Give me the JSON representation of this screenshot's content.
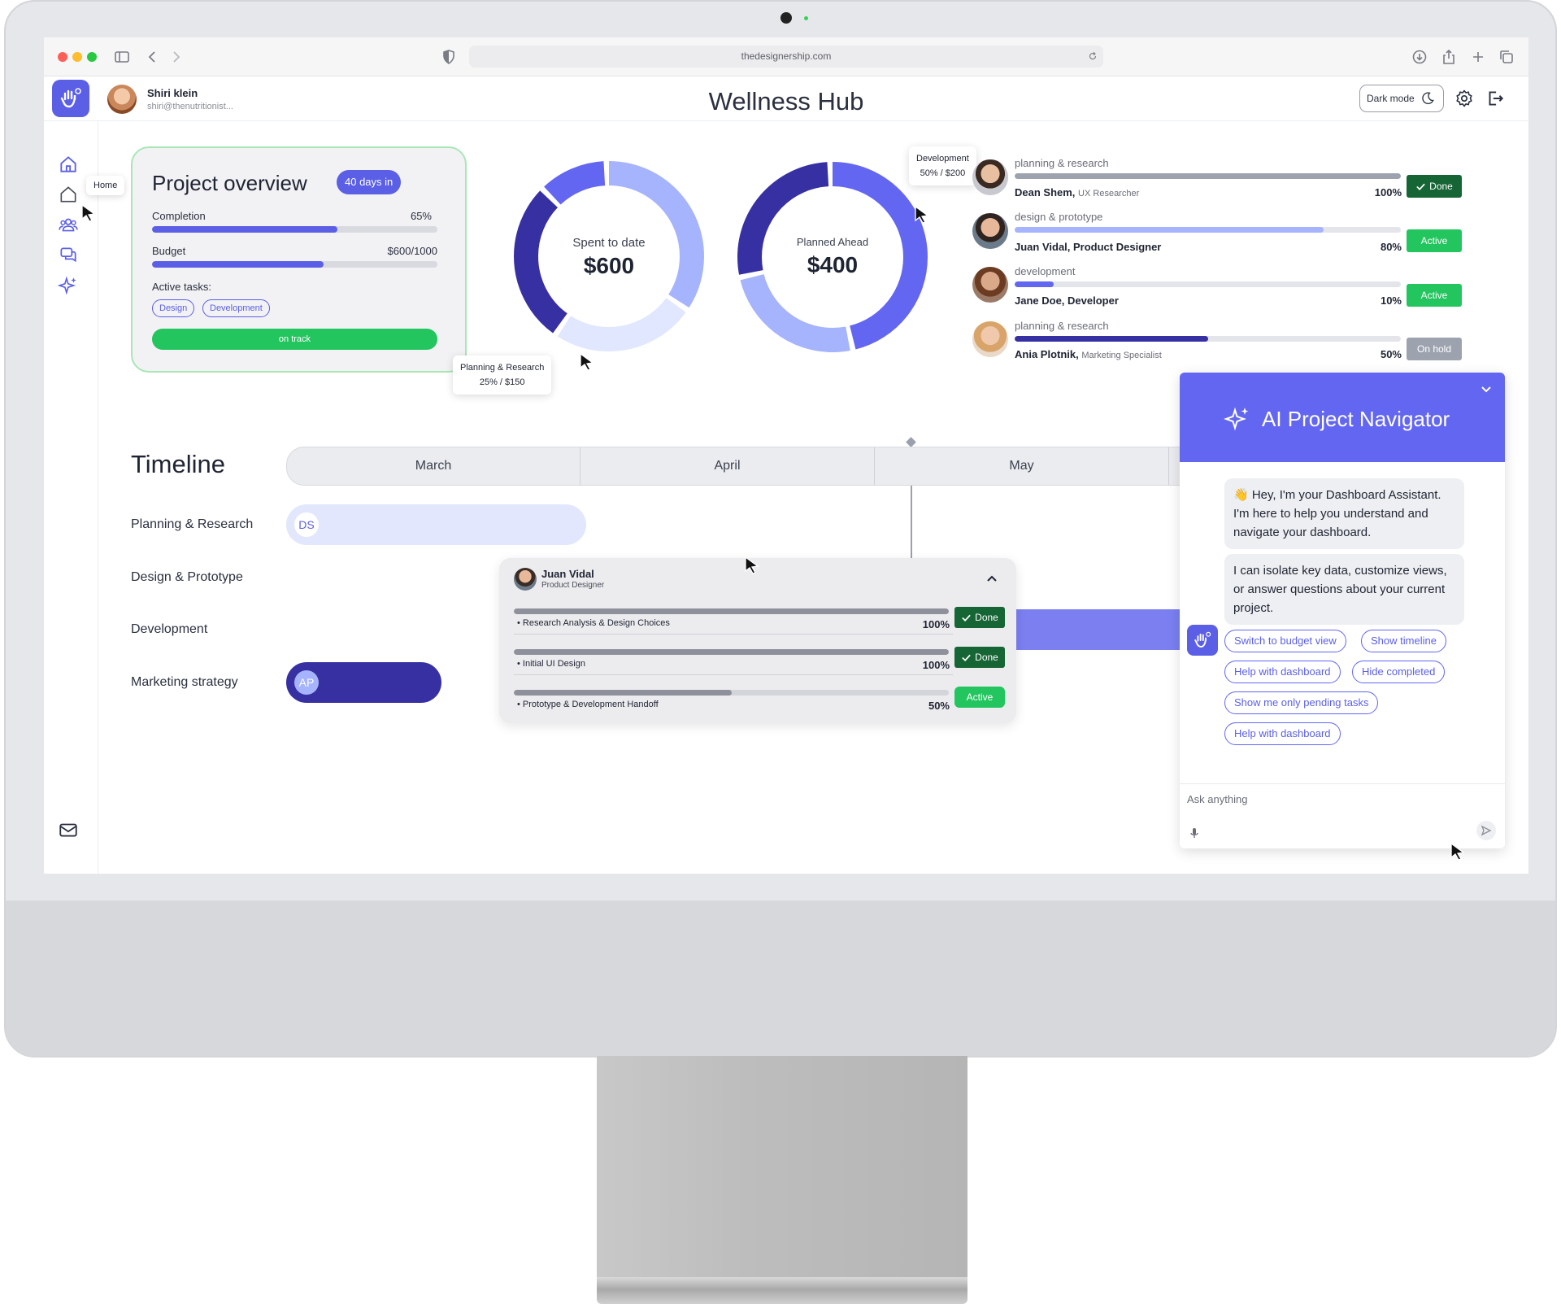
{
  "browser": {
    "url": "thedesignership.com"
  },
  "header": {
    "user_name": "Shiri klein",
    "user_email": "shiri@thenutritionist...",
    "title": "Wellness Hub",
    "dark_mode_label": "Dark mode"
  },
  "sidebar": {
    "tooltip": "Home",
    "items": [
      "home-icon",
      "home-outline-icon",
      "team-icon",
      "chat-icon",
      "sparkle-icon",
      "mail-icon"
    ]
  },
  "overview": {
    "title": "Project overview",
    "badge": "40 days in",
    "completion_label": "Completion",
    "completion_value": "65%",
    "completion_fraction": 0.65,
    "budget_label": "Budget",
    "budget_value": "$600/1000",
    "budget_fraction": 0.6,
    "active_tasks_label": "Active tasks:",
    "tasks": [
      "Design",
      "Development"
    ],
    "status": "on track"
  },
  "donuts": [
    {
      "label": "Spent to date",
      "amount": "$600",
      "tooltip_title": "Planning & Research",
      "tooltip_value": "25% / $150",
      "segments": [
        {
          "fraction": 0.35,
          "color": "#a5b4fc"
        },
        {
          "fraction": 0.25,
          "color": "#e0e7ff"
        },
        {
          "fraction": 0.28,
          "color": "#3730a3"
        },
        {
          "fraction": 0.12,
          "color": "#6366f1"
        }
      ]
    },
    {
      "label": "Planned Ahead",
      "amount": "$400",
      "tooltip_title": "Development",
      "tooltip_value": "50% / $200",
      "segments": [
        {
          "fraction": 0.47,
          "color": "#6366f1"
        },
        {
          "fraction": 0.25,
          "color": "#a5b4fc"
        },
        {
          "fraction": 0.28,
          "color": "#3730a3"
        }
      ]
    }
  ],
  "team": [
    {
      "category": "planning & research",
      "name": "Dean Shem,",
      "role": "UX Researcher",
      "percent": "100%",
      "fraction": 1.0,
      "fill": "#9ca3af",
      "status": "Done",
      "status_color": "#166534"
    },
    {
      "category": "design & prototype",
      "name": "Juan Vidal, Product Designer",
      "role": "",
      "percent": "80%",
      "fraction": 0.8,
      "fill": "#a5b4fc",
      "status": "Active",
      "status_color": "#22c55e"
    },
    {
      "category": "development",
      "name": "Jane Doe, Developer",
      "role": "",
      "percent": "10%",
      "fraction": 0.1,
      "fill": "#6366f1",
      "status": "Active",
      "status_color": "#22c55e"
    },
    {
      "category": "planning & research",
      "name": "Ania Plotnik,",
      "role": "Marketing Specialist",
      "percent": "50%",
      "fraction": 0.5,
      "fill": "#3730a3",
      "status": "On hold",
      "status_color": "#9ca3af"
    }
  ],
  "timeline": {
    "title": "Timeline",
    "months": [
      "March",
      "April",
      "May"
    ],
    "rows": [
      "Planning & Research",
      "Design & Prototype",
      "Development",
      "Marketing strategy"
    ],
    "planning_initials": "DS",
    "marketing_initials": "AP"
  },
  "task_popover": {
    "name": "Juan Vidal",
    "role": "Product Designer",
    "tasks": [
      {
        "label": "Research Analysis & Design Choices",
        "percent": "100%",
        "fraction": 1.0,
        "status": "Done",
        "status_color": "#166534"
      },
      {
        "label": "Initial UI Design",
        "percent": "100%",
        "fraction": 1.0,
        "status": "Done",
        "status_color": "#166534"
      },
      {
        "label": "Prototype & Development Handoff",
        "percent": "50%",
        "fraction": 0.5,
        "status": "Active",
        "status_color": "#22c55e"
      }
    ]
  },
  "ai": {
    "title": "AI Project Navigator",
    "message1": "👋 Hey, I'm your Dashboard Assistant. I'm here to help you understand and navigate your dashboard.",
    "message2": "I can isolate key data, customize views, or answer questions about your current project.",
    "chips": [
      "Switch to budget view",
      "Show timeline",
      "Help with dashboard",
      "Hide completed",
      "Show me only pending tasks",
      "Help with dashboard"
    ],
    "input_placeholder": "Ask anything"
  },
  "colors": {
    "accent": "#5b5fe6",
    "success": "#22c55e",
    "done": "#166534",
    "hold": "#9ca3af"
  }
}
